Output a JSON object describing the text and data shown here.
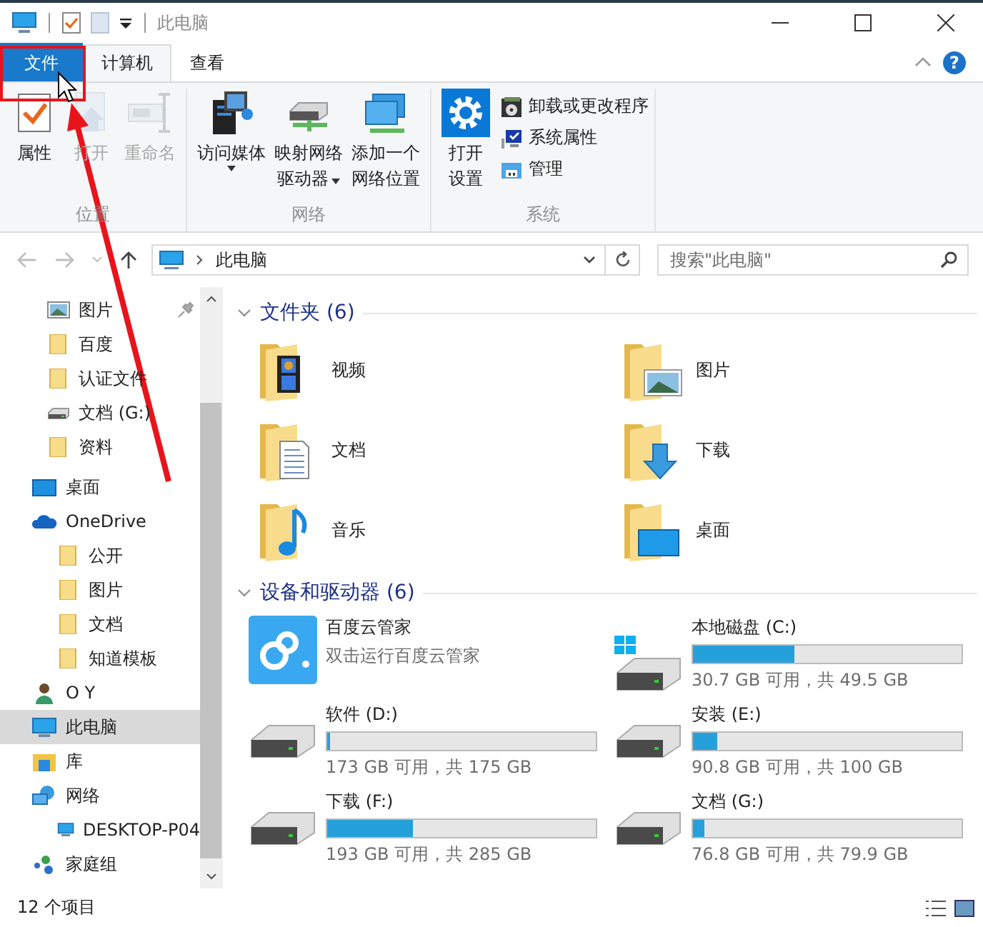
{
  "window": {
    "title": "此电脑"
  },
  "ribbon_tabs": [
    {
      "label": "文件",
      "selected": false,
      "kind": "file"
    },
    {
      "label": "计算机",
      "selected": true,
      "kind": "tab"
    },
    {
      "label": "查看",
      "selected": false,
      "kind": "tab"
    }
  ],
  "help_label": "?",
  "ribbon_groups": [
    {
      "label": "位置",
      "buttons": [
        {
          "kind": "large",
          "lines": [
            "属性"
          ],
          "disabled": false,
          "dropdown": false
        },
        {
          "kind": "large",
          "lines": [
            "打开"
          ],
          "disabled": true,
          "dropdown": false
        },
        {
          "kind": "large",
          "lines": [
            "重命名"
          ],
          "disabled": true,
          "dropdown": false
        }
      ]
    },
    {
      "label": "网络",
      "buttons": [
        {
          "kind": "large",
          "lines": [
            "访问媒体"
          ],
          "disabled": false,
          "dropdown": true
        },
        {
          "kind": "large",
          "lines": [
            "映射网络",
            "驱动器"
          ],
          "disabled": false,
          "dropdown": true
        },
        {
          "kind": "large",
          "lines": [
            "添加一个",
            "网络位置"
          ],
          "disabled": false,
          "dropdown": false
        }
      ]
    },
    {
      "label": "系统",
      "buttons": [
        {
          "kind": "large",
          "lines": [
            "打开",
            "设置"
          ],
          "disabled": false,
          "dropdown": false
        },
        {
          "kind": "small",
          "lines": [
            "卸载或更改程序"
          ],
          "disabled": false,
          "dropdown": false
        },
        {
          "kind": "small",
          "lines": [
            "系统属性"
          ],
          "disabled": false,
          "dropdown": false
        },
        {
          "kind": "small",
          "lines": [
            "管理"
          ],
          "disabled": false,
          "dropdown": false
        }
      ]
    }
  ],
  "address": {
    "path": "此电脑",
    "search_placeholder": "搜索\"此电脑\""
  },
  "quick_access": [
    {
      "label": "图片",
      "kind": "picture",
      "pinned": true,
      "selected": false
    },
    {
      "label": "百度",
      "kind": "folder",
      "pinned": false,
      "selected": false
    },
    {
      "label": "认证文件",
      "kind": "folder",
      "pinned": false,
      "selected": false
    },
    {
      "label": "文档 (G:)",
      "kind": "drive",
      "pinned": false,
      "selected": false
    },
    {
      "label": "资料",
      "kind": "folder",
      "pinned": false,
      "selected": false
    }
  ],
  "nav_items": [
    {
      "label": "桌面",
      "kind": "desktop",
      "selected": false
    },
    {
      "label": "OneDrive",
      "kind": "onedrive",
      "selected": false,
      "children": [
        {
          "label": "公开",
          "kind": "folder",
          "selected": false
        },
        {
          "label": "图片",
          "kind": "folder",
          "selected": false
        },
        {
          "label": "文档",
          "kind": "folder",
          "selected": false
        },
        {
          "label": "知道模板",
          "kind": "folder",
          "selected": false
        }
      ]
    },
    {
      "label": "O Y",
      "kind": "user",
      "selected": false
    },
    {
      "label": "此电脑",
      "kind": "pc",
      "selected": true
    },
    {
      "label": "库",
      "kind": "library",
      "selected": false
    },
    {
      "label": "网络",
      "kind": "network",
      "selected": false,
      "children": [
        {
          "label": "DESKTOP-P04",
          "kind": "pc",
          "selected": false
        }
      ]
    },
    {
      "label": "家庭组",
      "kind": "homegroup",
      "selected": false
    }
  ],
  "folders": {
    "title": "文件夹 (6)",
    "items": [
      {
        "label": "视频",
        "kind": "video"
      },
      {
        "label": "图片",
        "kind": "pictures"
      },
      {
        "label": "文档",
        "kind": "documents"
      },
      {
        "label": "下载",
        "kind": "downloads"
      },
      {
        "label": "音乐",
        "kind": "music"
      },
      {
        "label": "桌面",
        "kind": "desktop"
      }
    ]
  },
  "devices": {
    "title": "设备和驱动器 (6)",
    "items": [
      {
        "kind": "app",
        "name": "百度云管家",
        "note": "双击运行百度云管家"
      },
      {
        "kind": "system",
        "name": "本地磁盘 (C:)",
        "level": 0.38,
        "note": "30.7 GB 可用，共 49.5 GB"
      },
      {
        "kind": "drive",
        "name": "软件 (D:)",
        "level": 0.01,
        "note": "173 GB 可用，共 175 GB"
      },
      {
        "kind": "drive",
        "name": "安装 (E:)",
        "level": 0.09,
        "note": "90.8 GB 可用，共 100 GB"
      },
      {
        "kind": "drive",
        "name": "下载 (F:)",
        "level": 0.32,
        "note": "193 GB 可用，共 285 GB"
      },
      {
        "kind": "drive",
        "name": "文档 (G:)",
        "level": 0.04,
        "note": "76.8 GB 可用，共 79.9 GB"
      }
    ]
  },
  "status_bar": {
    "count": "12 个项目"
  }
}
